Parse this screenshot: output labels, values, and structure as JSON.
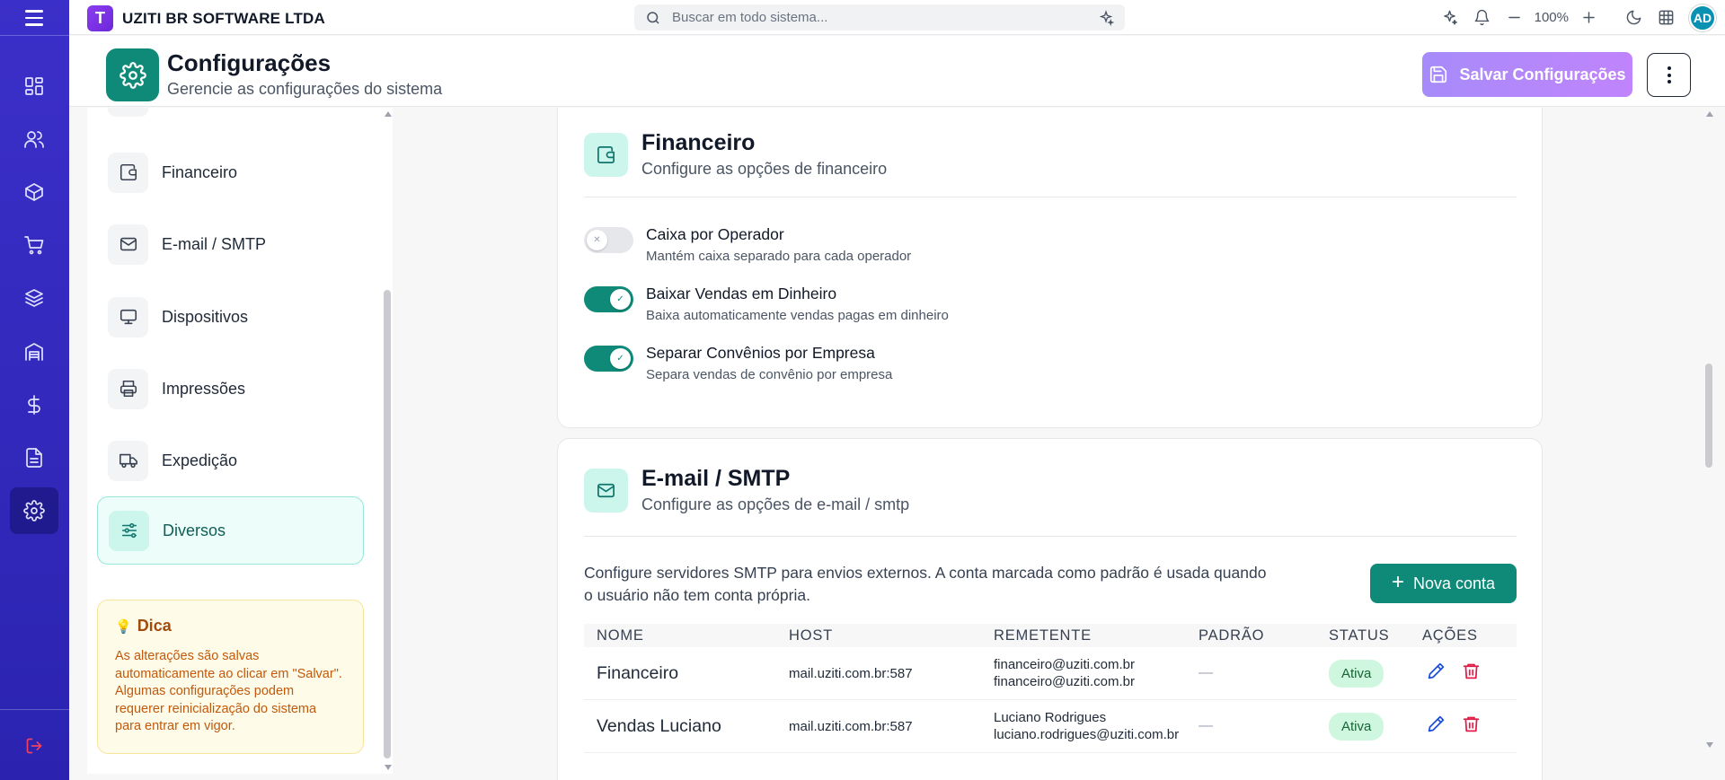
{
  "topbar": {
    "brand_name": "UZITI BR SOFTWARE LTDA",
    "brand_letter": "T",
    "search_placeholder": "Buscar em todo sistema...",
    "zoom": "100%",
    "avatar_initials": "AD"
  },
  "rail": {
    "items": [
      "dashboard",
      "clientes",
      "produtos",
      "vendas",
      "estoque",
      "armazem",
      "financeiro",
      "documentos",
      "configuracoes"
    ],
    "active": "configuracoes"
  },
  "header": {
    "title": "Configurações",
    "subtitle": "Gerencie as configurações do sistema",
    "save_label": "Salvar Configurações"
  },
  "nav": {
    "items": [
      {
        "label": "Financeiro",
        "icon": "wallet-icon"
      },
      {
        "label": "E-mail / SMTP",
        "icon": "mail-icon"
      },
      {
        "label": "Dispositivos",
        "icon": "monitor-icon"
      },
      {
        "label": "Impressões",
        "icon": "printer-icon"
      },
      {
        "label": "Expedição",
        "icon": "truck-icon"
      },
      {
        "label": "Diversos",
        "icon": "sliders-icon"
      }
    ],
    "active": "Diversos",
    "tip": {
      "title": "Dica",
      "text": "As alterações são salvas automaticamente ao clicar em \"Salvar\". Algumas configurações podem requerer reinicialização do sistema para entrar em vigor."
    }
  },
  "financeiro": {
    "title": "Financeiro",
    "subtitle": "Configure as opções de financeiro",
    "toggles": [
      {
        "title": "Caixa por Operador",
        "desc": "Mantém caixa separado para cada operador",
        "on": false
      },
      {
        "title": "Baixar Vendas em Dinheiro",
        "desc": "Baixa automaticamente vendas pagas em dinheiro",
        "on": true
      },
      {
        "title": "Separar Convênios por Empresa",
        "desc": "Separa vendas de convênio por empresa",
        "on": true
      }
    ]
  },
  "email": {
    "title": "E-mail / SMTP",
    "subtitle": "Configure as opções de e-mail / smtp",
    "intro": "Configure servidores SMTP para envios externos. A conta marcada como padrão é usada quando o usuário não tem conta própria.",
    "new_account_label": "Nova conta",
    "columns": [
      "NOME",
      "HOST",
      "REMETENTE",
      "PADRÃO",
      "STATUS",
      "AÇÕES"
    ],
    "rows": [
      {
        "name": "Financeiro",
        "host": "mail.uziti.com.br:587",
        "sender_name": "financeiro@uziti.com.br",
        "sender_email": "financeiro@uziti.com.br",
        "default": "—",
        "status": "Ativa"
      },
      {
        "name": "Vendas Luciano",
        "host": "mail.uziti.com.br:587",
        "sender_name": "Luciano Rodrigues",
        "sender_email": "luciano.rodrigues@uziti.com.br",
        "default": "—",
        "status": "Ativa"
      }
    ]
  },
  "colors": {
    "rail": "#3b2fc9",
    "accent": "#0f8a78",
    "save_button": "#a78bfa",
    "status_active_bg": "#cff7e0"
  }
}
